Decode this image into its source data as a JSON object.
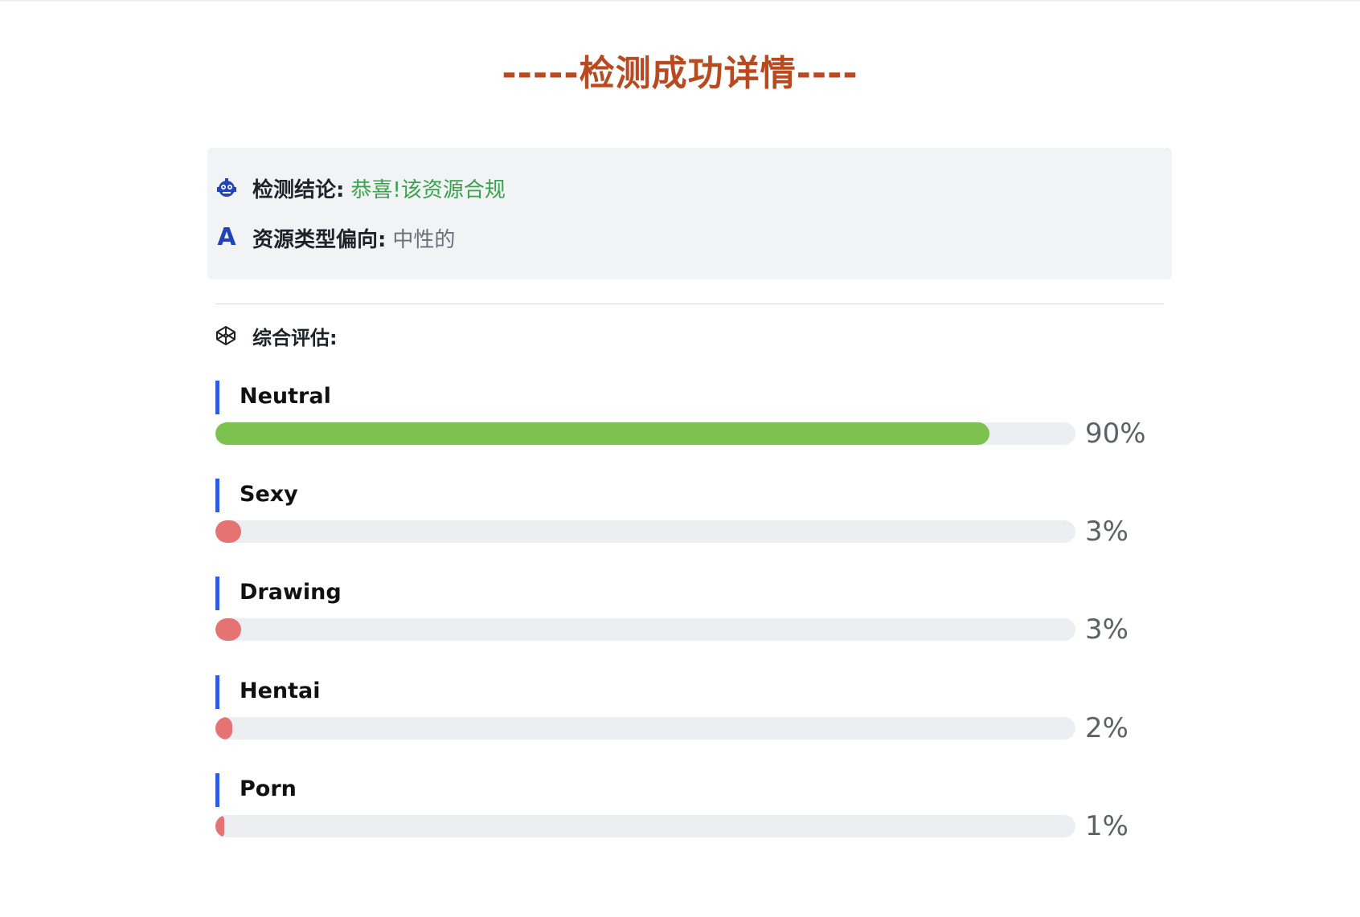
{
  "header": {
    "title": "-----检测成功详情----"
  },
  "summary": {
    "conclusion_label": "检测结论:",
    "conclusion_value": "恭喜!该资源合规",
    "type_icon_letter": "A",
    "type_label": "资源类型偏向:",
    "type_value": "中性的"
  },
  "assessment": {
    "heading": "综合评估:",
    "colors": {
      "high": "#7dc24f",
      "low": "#e57373",
      "marker": "#2f5be3"
    },
    "metrics": [
      {
        "name": "Neutral",
        "percent_label": "90%",
        "value": 0.9,
        "level": "high"
      },
      {
        "name": "Sexy",
        "percent_label": "3%",
        "value": 0.03,
        "level": "low"
      },
      {
        "name": "Drawing",
        "percent_label": "3%",
        "value": 0.03,
        "level": "low"
      },
      {
        "name": "Hentai",
        "percent_label": "2%",
        "value": 0.02,
        "level": "low"
      },
      {
        "name": "Porn",
        "percent_label": "1%",
        "value": 0.01,
        "level": "low"
      }
    ]
  }
}
